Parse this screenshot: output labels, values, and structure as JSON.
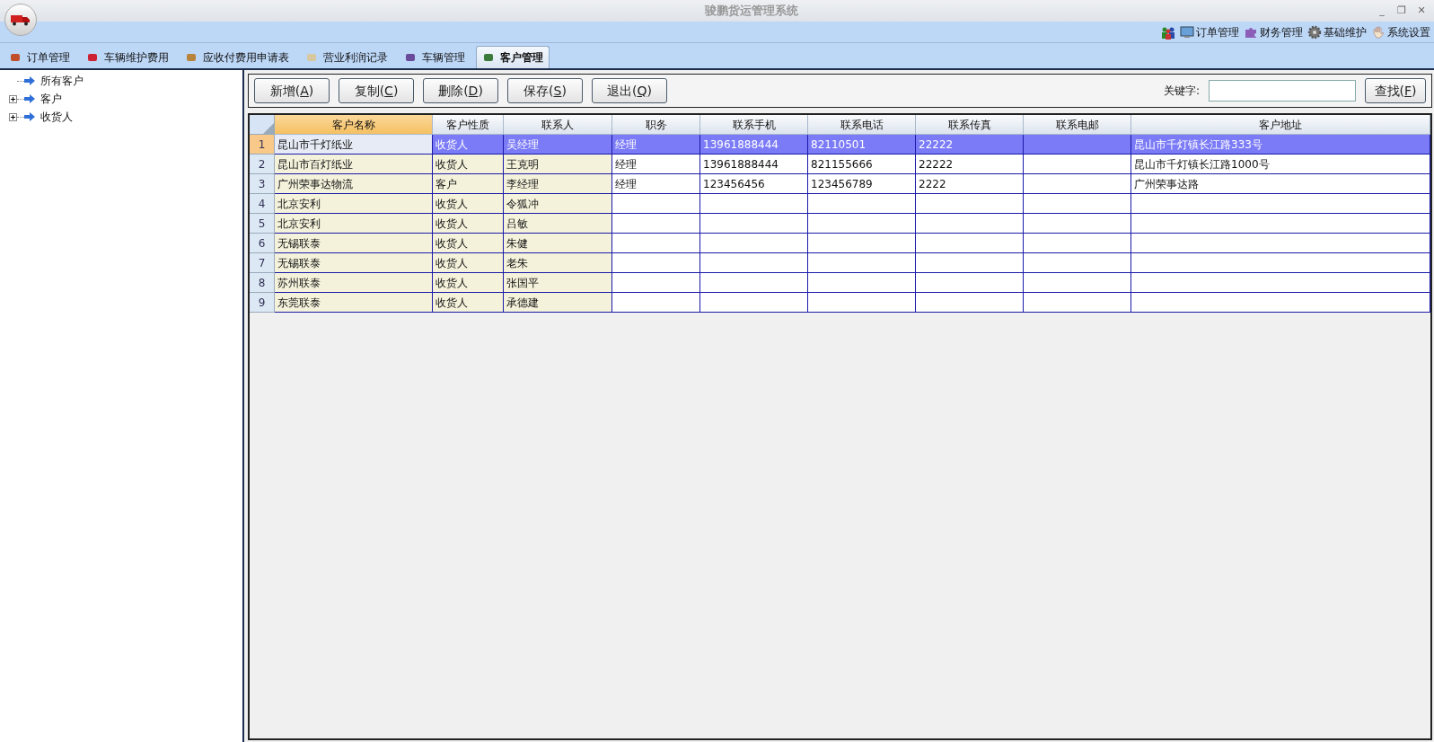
{
  "window": {
    "title": "骏鹏货运管理系统",
    "controls": [
      "_",
      "❐",
      "✕"
    ]
  },
  "quick_menu": [
    {
      "label": "订单管理"
    },
    {
      "label": "财务管理"
    },
    {
      "label": "基础维护"
    },
    {
      "label": "系统设置"
    }
  ],
  "tabs": [
    {
      "label": "订单管理",
      "selected": false
    },
    {
      "label": "车辆维护费用",
      "selected": false
    },
    {
      "label": "应收付费用申请表",
      "selected": false
    },
    {
      "label": "营业利润记录",
      "selected": false
    },
    {
      "label": "车辆管理",
      "selected": false
    },
    {
      "label": "客户管理",
      "selected": true
    }
  ],
  "tree": [
    {
      "label": "所有客户",
      "kind": "leaf"
    },
    {
      "label": "客户",
      "kind": "group",
      "expanded": false
    },
    {
      "label": "收货人",
      "kind": "group",
      "expanded": false
    }
  ],
  "buttons": [
    {
      "label": "新增(",
      "key": "A",
      "suffix": ")"
    },
    {
      "label": "复制(",
      "key": "C",
      "suffix": ")"
    },
    {
      "label": "删除(",
      "key": "D",
      "suffix": ")"
    },
    {
      "label": "保存(",
      "key": "S",
      "suffix": ")"
    },
    {
      "label": "退出(",
      "key": "Q",
      "suffix": ")"
    }
  ],
  "search": {
    "label": "关键字:",
    "button": {
      "label": "查找(",
      "key": "F",
      "suffix": ")"
    }
  },
  "table": {
    "columns": [
      {
        "label": "客户名称",
        "selected": true
      },
      {
        "label": "客户性质",
        "selected": false
      },
      {
        "label": "联系人",
        "selected": false
      },
      {
        "label": "职务",
        "selected": false
      },
      {
        "label": "联系手机",
        "selected": false
      },
      {
        "label": "联系电话",
        "selected": false
      },
      {
        "label": "联系传真",
        "selected": false
      },
      {
        "label": "联系电邮",
        "selected": false
      },
      {
        "label": "客户地址",
        "selected": false
      }
    ],
    "rows": [
      {
        "number": "1",
        "selected": true,
        "cells": [
          "昆山市千灯纸业",
          "收货人",
          "吴经理",
          "经理",
          "13961888444",
          "82110501",
          "22222",
          "",
          "昆山市千灯镇长江路333号"
        ]
      },
      {
        "number": "2",
        "selected": false,
        "cells": [
          "昆山市百灯纸业",
          "收货人",
          "王克明",
          "经理",
          "13961888444",
          "821155666",
          "22222",
          "",
          "昆山市千灯镇长江路1000号"
        ]
      },
      {
        "number": "3",
        "selected": false,
        "cells": [
          "广州荣事达物流",
          "客户",
          "李经理",
          "经理",
          "123456456",
          "123456789",
          "2222",
          "",
          "广州荣事达路"
        ]
      },
      {
        "number": "4",
        "selected": false,
        "cells": [
          "北京安利",
          "收货人",
          "令狐冲",
          "",
          "",
          "",
          "",
          "",
          ""
        ]
      },
      {
        "number": "5",
        "selected": false,
        "cells": [
          "北京安利",
          "收货人",
          "吕敏",
          "",
          "",
          "",
          "",
          "",
          ""
        ]
      },
      {
        "number": "6",
        "selected": false,
        "cells": [
          "无锡联泰",
          "收货人",
          "朱健",
          "",
          "",
          "",
          "",
          "",
          ""
        ]
      },
      {
        "number": "7",
        "selected": false,
        "cells": [
          "无锡联泰",
          "收货人",
          "老朱",
          "",
          "",
          "",
          "",
          "",
          ""
        ]
      },
      {
        "number": "8",
        "selected": false,
        "cells": [
          "苏州联泰",
          "收货人",
          "张国平",
          "",
          "",
          "",
          "",
          "",
          ""
        ]
      },
      {
        "number": "9",
        "selected": false,
        "cells": [
          "东莞联泰",
          "收货人",
          "承德建",
          "",
          "",
          "",
          "",
          "",
          ""
        ]
      }
    ]
  }
}
